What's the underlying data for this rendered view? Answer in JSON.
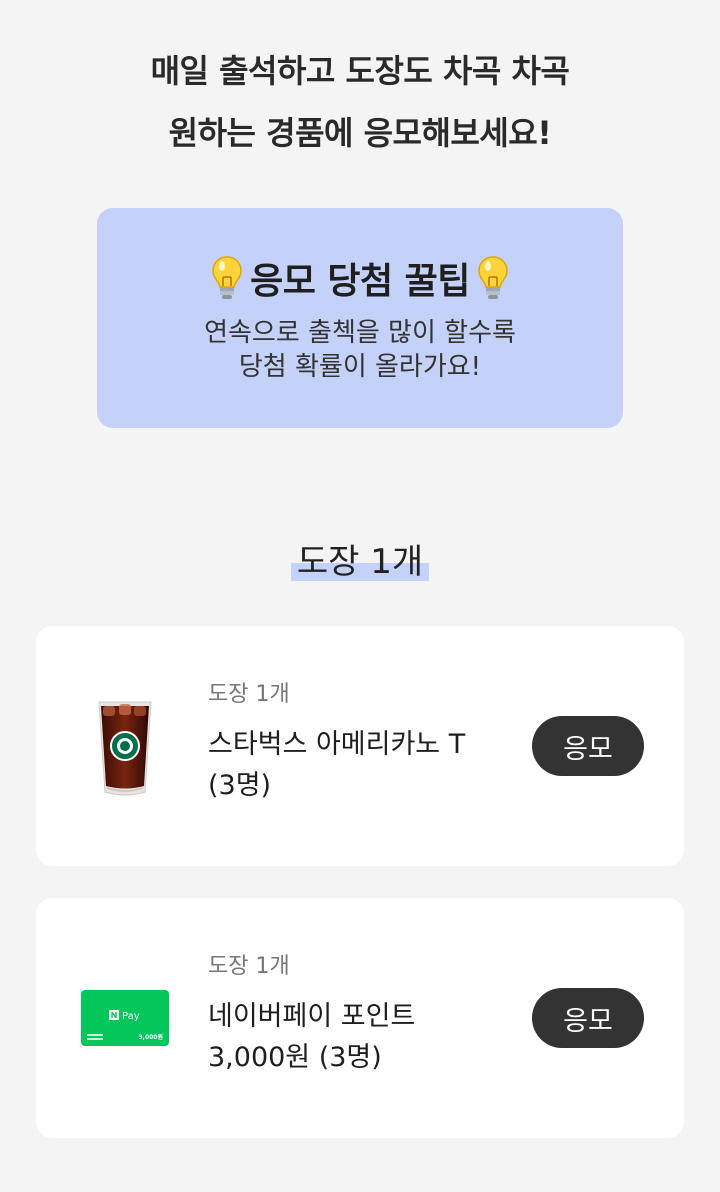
{
  "headline": {
    "line1": "매일 출석하고 도장도 차곡 차곡",
    "line2": "원하는 경품에 응모해보세요!"
  },
  "tip": {
    "title": "응모 당첨 꿀팁",
    "icon": "lightbulb-icon",
    "desc_line1": "연속으로 출첵을 많이 할수록",
    "desc_line2": "당첨 확률이 올라가요!",
    "bg_color": "#c4d2fa"
  },
  "section": {
    "title": "도장 1개",
    "highlight_color": "#c4d2fa"
  },
  "prizes": [
    {
      "stamp": "도장 1개",
      "name_line1": "스타벅스 아메리카노 T",
      "name_line2": "(3명)",
      "button": "응모",
      "icon": "iced-americano-cup-icon"
    },
    {
      "stamp": "도장 1개",
      "name_line1": "네이버페이 포인트",
      "name_line2": "3,000원 (3명)",
      "button": "응모",
      "icon": "naver-pay-card-icon",
      "card_label": "Pay",
      "card_amount": "3,000원",
      "card_color": "#03c75a"
    }
  ],
  "colors": {
    "page_bg": "#f4f4f4",
    "button_bg": "#333333"
  }
}
